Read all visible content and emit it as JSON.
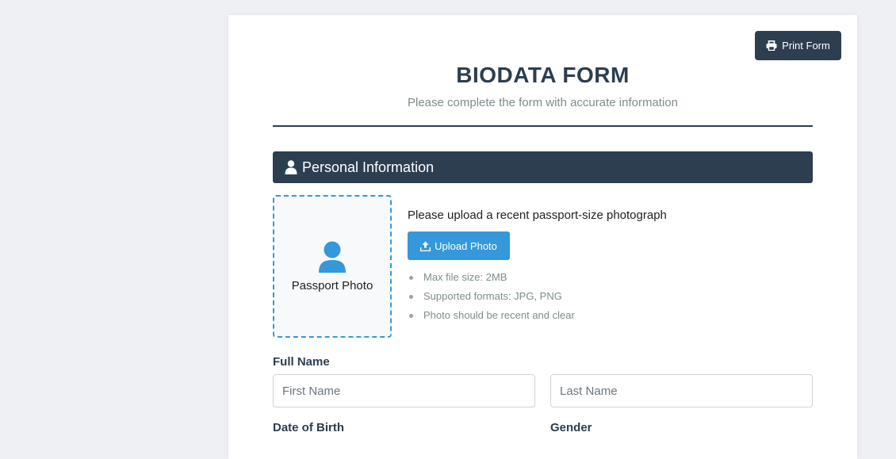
{
  "form": {
    "print_label": "Print Form",
    "title": "BIODATA FORM",
    "subtitle": "Please complete the form with accurate information"
  },
  "personal_section": {
    "title": "Personal Information",
    "photo_label": "Passport Photo",
    "upload_instructions": "Please upload a recent passport-size photograph",
    "upload_button": "Upload Photo",
    "upload_notes": [
      "Max file size: 2MB",
      "Supported formats: JPG, PNG",
      "Photo should be recent and clear"
    ],
    "full_name_label": "Full Name",
    "first_name_placeholder": "First Name",
    "last_name_placeholder": "Last Name",
    "dob_label": "Date of Birth",
    "gender_label": "Gender"
  },
  "colors": {
    "primary": "#2c3e50",
    "accent": "#3498db"
  },
  "icons": {
    "print": "printer-icon",
    "section": "user-icon",
    "photo": "user-avatar-icon",
    "upload": "upload-icon"
  }
}
